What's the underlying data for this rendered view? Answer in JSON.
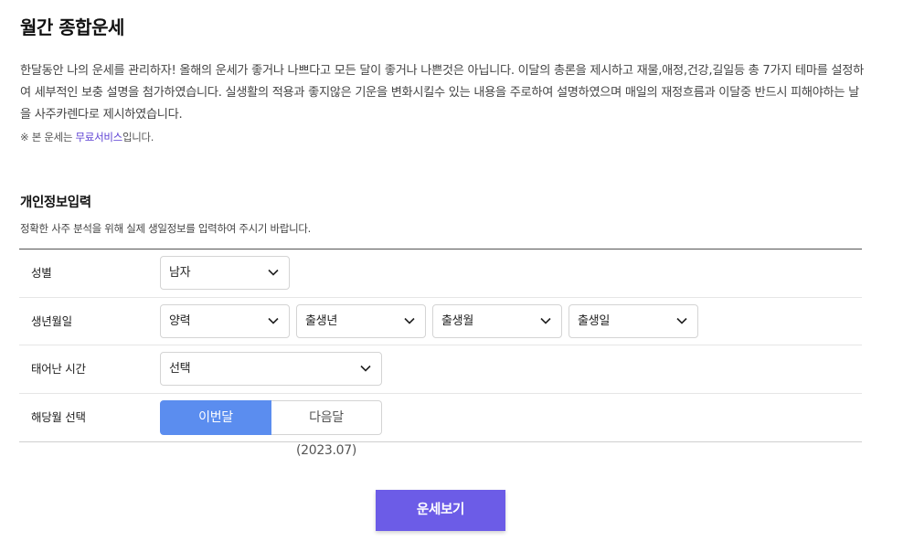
{
  "page": {
    "title": "월간 종합운세",
    "description": "한달동안 나의 운세를 관리하자! 올해의 운세가 좋거나 나쁘다고 모든 달이 좋거나 나쁜것은 아닙니다. 이달의 총론을 제시하고 재물,애정,건강,길일등 총 7가지 테마를 설정하여 세부적인 보충 설명을 첨가하였습니다. 실생활의 적용과 좋지않은 기운을 변화시킬수 있는 내용을 주로하여 설명하였으며 매일의 재정흐름과 이달중 반드시 피해야하는 날을 사주카렌다로 제시하였습니다.",
    "notice_prefix": "※ 본 운세는 ",
    "notice_highlight": "무료서비스",
    "notice_suffix": "입니다."
  },
  "form": {
    "title": "개인정보입력",
    "subtitle": "정확한 사주 분석을 위해 실제 생일정보를 입력하여 주시기 바랍니다.",
    "gender": {
      "label": "성별",
      "value": "남자"
    },
    "birth": {
      "label": "생년월일",
      "calendar": "양력",
      "year": "출생년",
      "month": "출생월",
      "day": "출생일"
    },
    "birth_time": {
      "label": "태어난 시간",
      "value": "선택"
    },
    "month_select": {
      "label": "해당월 선택",
      "options": [
        "이번달(2023.06)",
        "다음달(2023.07)"
      ],
      "selected": "이번달(2023.06)"
    }
  },
  "submit_label": "운세보기",
  "colors": {
    "accent_purple": "#6c5ce7",
    "segment_active_blue": "#5b8def",
    "highlight_text": "#5b3fd3"
  },
  "icons": {
    "dropdown": "chevron-down-icon"
  }
}
